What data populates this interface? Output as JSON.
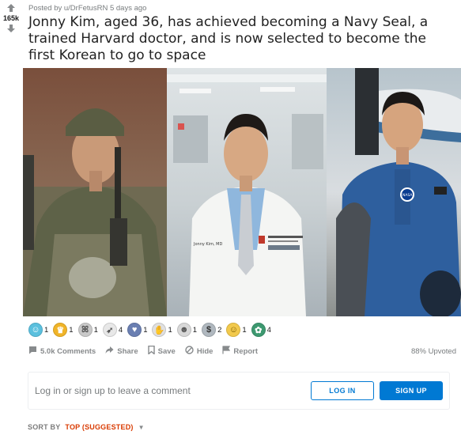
{
  "post": {
    "meta": "Posted by u/DrFetusRN 5 days ago",
    "score": "165k",
    "title": "Jonny Kim, aged 36, has achieved becoming a Navy Seal, a trained Harvard doctor, and is now selected to become the first Korean to go to space"
  },
  "awards": [
    {
      "icon": "laughing-face-award-icon",
      "count": "1",
      "color": "#5bc0de"
    },
    {
      "icon": "crown-award-icon",
      "count": "1",
      "color": "#f0b429"
    },
    {
      "icon": "butterfly-award-icon",
      "count": "1",
      "color": "#c9c9c9"
    },
    {
      "icon": "rocket-award-icon",
      "count": "4",
      "color": "#e8e8e8"
    },
    {
      "icon": "hug-award-icon",
      "count": "1",
      "color": "#6a7fb2"
    },
    {
      "icon": "wave-hand-award-icon",
      "count": "1",
      "color": "#e0e0e0"
    },
    {
      "icon": "bubble-face-award-icon",
      "count": "1",
      "color": "#d8d8d8"
    },
    {
      "icon": "silver-award-icon",
      "count": "2",
      "color": "#b0b8bf"
    },
    {
      "icon": "gold-face-award-icon",
      "count": "1",
      "color": "#f2c94c"
    },
    {
      "icon": "wholesome-award-icon",
      "count": "4",
      "color": "#3d9970"
    }
  ],
  "actions": {
    "comments": "5.0k Comments",
    "share": "Share",
    "save": "Save",
    "hide": "Hide",
    "report": "Report",
    "upvoted": "88% Upvoted"
  },
  "comment_box": {
    "prompt": "Log in or sign up to leave a comment",
    "login": "LOG IN",
    "signup": "SIGN UP"
  },
  "sort": {
    "label": "SORT BY",
    "value": "TOP (SUGGESTED)"
  },
  "photo": {
    "label_coat": "Jonny Kim, MD",
    "label_coat_patch": "HARVARD AFFILIATED EMERGENCY MEDICINE RESIDENCY",
    "label_nasa": "NASA"
  },
  "colors": {
    "accent": "#0079d3",
    "sort": "#d93a00",
    "muted": "#878a8c"
  }
}
